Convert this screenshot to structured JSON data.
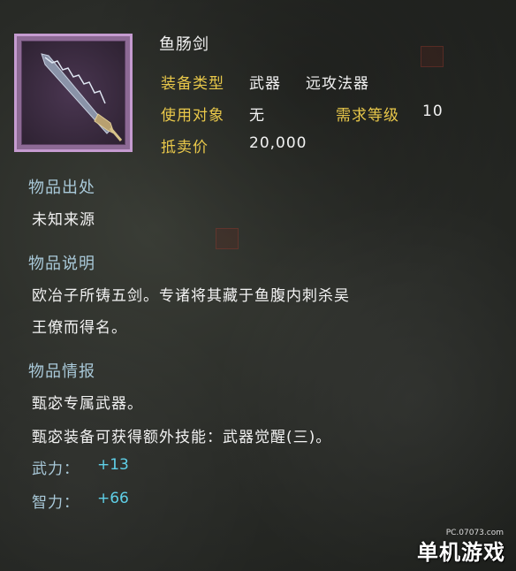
{
  "item": {
    "name": "鱼肠剑",
    "icon": "sword-icon",
    "equip_type_label": "装备类型",
    "equip_type_value": "武器",
    "equip_subtype": "远攻法器",
    "target_label": "使用对象",
    "target_value": "无",
    "level_req_label": "需求等级",
    "level_req_value": "10",
    "sell_price_label": "抵卖价",
    "sell_price_value": "20,000"
  },
  "sections": {
    "origin_head": "物品出处",
    "origin_text": "未知来源",
    "desc_head": "物品说明",
    "desc_line1": "欧冶子所铸五剑。专诸将其藏于鱼腹内刺杀吴",
    "desc_line2": "王僚而得名。",
    "info_head": "物品情报",
    "info_line1": "甄宓专属武器。",
    "info_line2": "甄宓装备可获得额外技能：武器觉醒(三)。"
  },
  "stats": {
    "wu_label": "武力：",
    "wu_value": "+13",
    "zhi_label": "智力：",
    "zhi_value": "+66"
  },
  "watermark": {
    "url": "PC.07073.com",
    "brand": "单机游戏"
  },
  "colors": {
    "gold": "#e9c84a",
    "section_blue": "#a9c9d9",
    "stat_cyan": "#5fd0e8",
    "frame_purple": "#c59bd0"
  }
}
